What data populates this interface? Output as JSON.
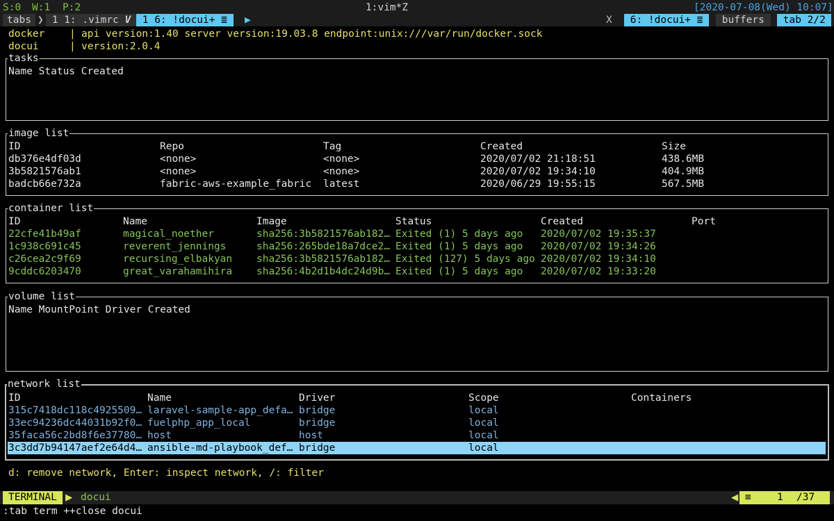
{
  "tabline": {
    "counters": {
      "s": "S:0",
      "w": "W:1",
      "p": "P:2"
    },
    "center_title": "1:vim*Z",
    "datetime": "[2020-07-08(Wed) 10:07]",
    "tabs_label": "tabs",
    "tab1": " 1 1: .vimrc ",
    "tab1_mark": "V",
    "tab2": " 1 6: !docui+ ",
    "close_x": "X",
    "right_tab": " 6: !docui+ ",
    "buffers_label": " buffers ",
    "tab_count": " tab 2/2 "
  },
  "info": {
    "docker_label": "docker",
    "docker_value": "api version:1.40 server version:19.03.8 endpoint:unix:///var/run/docker.sock",
    "docui_label": "docui",
    "docui_value": "version:2.0.4",
    "sep": "|"
  },
  "tasks": {
    "title": "tasks",
    "header": "Name Status Created"
  },
  "images": {
    "title": "image list",
    "headers": [
      "ID",
      "Repo",
      "Tag",
      "Created",
      "Size"
    ],
    "rows": [
      [
        "db376e4df03d",
        "<none>",
        "<none>",
        "2020/07/02 21:18:51",
        "438.6MB"
      ],
      [
        "3b5821576ab1",
        "<none>",
        "<none>",
        "2020/07/02 19:34:10",
        "404.9MB"
      ],
      [
        "badcb66e732a",
        "fabric-aws-example_fabric",
        "latest",
        "2020/06/29 19:55:15",
        "567.5MB"
      ]
    ]
  },
  "containers": {
    "title": "container list",
    "headers": [
      "ID",
      "Name",
      "Image",
      "Status",
      "Created",
      "Port"
    ],
    "rows": [
      [
        "22cfe41b49af",
        "magical_noether",
        "sha256:3b5821576ab182…",
        "Exited (1) 5 days ago",
        "2020/07/02 19:35:37",
        ""
      ],
      [
        "1c938c691c45",
        "reverent_jennings",
        "sha256:265bde18a7dce2…",
        "Exited (1) 5 days ago",
        "2020/07/02 19:34:26",
        ""
      ],
      [
        "c26cea2c9f69",
        "recursing_elbakyan",
        "sha256:3b5821576ab182…",
        "Exited (127) 5 days ago",
        "2020/07/02 19:34:10",
        ""
      ],
      [
        "9cddc6203470",
        "great_varahamihira",
        "sha256:4b2d1b4dc24d9b…",
        "Exited (1) 5 days ago",
        "2020/07/02 19:33:20",
        ""
      ]
    ]
  },
  "volumes": {
    "title": "volume list",
    "header": "Name MountPoint Driver Created"
  },
  "networks": {
    "title": "network list",
    "headers": [
      "ID",
      "Name",
      "Driver",
      "Scope",
      "Containers"
    ],
    "rows": [
      [
        "315c7418dc118c4925509…",
        "laravel-sample-app_defa…",
        "bridge",
        "local",
        ""
      ],
      [
        "33ec94236dc44031b92f0…",
        "fuelphp_app_local",
        "bridge",
        "local",
        ""
      ],
      [
        "35faca56c2bd8f6e37780…",
        "host",
        "host",
        "local",
        ""
      ],
      [
        "3c3dd7b94147aef2e64d4…",
        "ansible-md-playbook_def…",
        "bridge",
        "local",
        ""
      ]
    ],
    "selected_index": 3
  },
  "help_text": "d: remove network, Enter: inspect network, /: filter",
  "statusline": {
    "mode": "TERMINAL",
    "buffer_name": "docui",
    "menu_icon": "≡",
    "position": "1",
    "total": "/37"
  },
  "cmdline": ":tab term ++close docui",
  "colors": {
    "accent_cyan": "#5fc8f0",
    "selection": "#8fd4f6",
    "terminal_badge": "#d7e65a",
    "info_yellow": "#e6e06a",
    "container_green": "#87c35a",
    "network_blue": "#7fb3e0"
  }
}
